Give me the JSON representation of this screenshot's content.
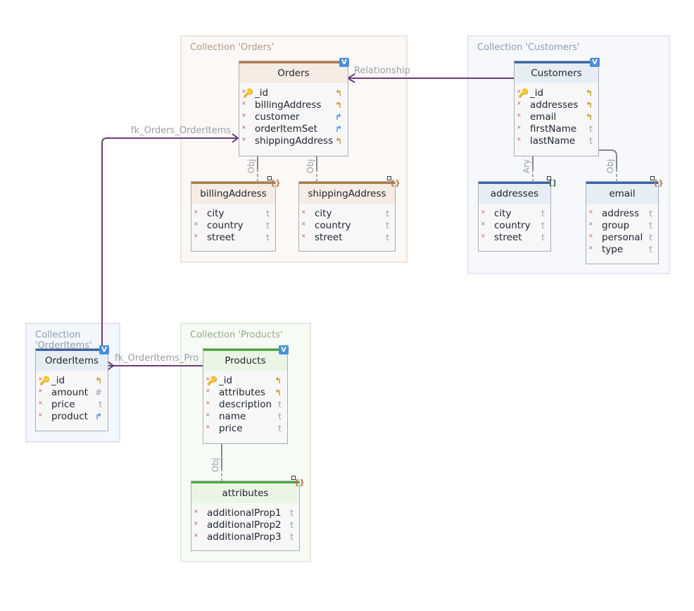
{
  "containers": {
    "orders": {
      "title": "Collection 'Orders'"
    },
    "customers": {
      "title": "Collection 'Customers'"
    },
    "orderitems": {
      "title": "Collection 'OrderItems'"
    },
    "products": {
      "title": "Collection 'Products'"
    }
  },
  "entities": {
    "orders": {
      "name": "Orders",
      "badge": "V",
      "fields": [
        {
          "name": "_id",
          "type": "↰",
          "key": true
        },
        {
          "name": "billingAddress",
          "type": "↰"
        },
        {
          "name": "customer",
          "type": "↱"
        },
        {
          "name": "orderItemSet",
          "type": "↱"
        },
        {
          "name": "shippingAddress",
          "type": "↰"
        }
      ]
    },
    "billingAddress": {
      "name": "billingAddress",
      "icon": "{}",
      "fields": [
        {
          "name": "city",
          "type": "t"
        },
        {
          "name": "country",
          "type": "t"
        },
        {
          "name": "street",
          "type": "t"
        }
      ]
    },
    "shippingAddress": {
      "name": "shippingAddress",
      "icon": "{}",
      "fields": [
        {
          "name": "city",
          "type": "t"
        },
        {
          "name": "country",
          "type": "t"
        },
        {
          "name": "street",
          "type": "t"
        }
      ]
    },
    "customers": {
      "name": "Customers",
      "badge": "V",
      "fields": [
        {
          "name": "_id",
          "type": "↰",
          "key": true
        },
        {
          "name": "addresses",
          "type": "↰"
        },
        {
          "name": "email",
          "type": "↰"
        },
        {
          "name": "firstName",
          "type": "t"
        },
        {
          "name": "lastName",
          "type": "t"
        }
      ]
    },
    "addresses": {
      "name": "addresses",
      "icon": "[]",
      "fields": [
        {
          "name": "city",
          "type": "t"
        },
        {
          "name": "country",
          "type": "t"
        },
        {
          "name": "street",
          "type": "t"
        }
      ]
    },
    "email": {
      "name": "email",
      "icon": "{}",
      "fields": [
        {
          "name": "address",
          "type": "t"
        },
        {
          "name": "group",
          "type": "t"
        },
        {
          "name": "personal",
          "type": "t"
        },
        {
          "name": "type",
          "type": "t"
        }
      ]
    },
    "orderitems": {
      "name": "OrderItems",
      "badge": "V",
      "fields": [
        {
          "name": "_id",
          "type": "↰",
          "key": true
        },
        {
          "name": "amount",
          "type": "#"
        },
        {
          "name": "price",
          "type": "t"
        },
        {
          "name": "product",
          "type": "↱"
        }
      ]
    },
    "products": {
      "name": "Products",
      "badge": "V",
      "fields": [
        {
          "name": "_id",
          "type": "↰",
          "key": true
        },
        {
          "name": "attributes",
          "type": "↰"
        },
        {
          "name": "description",
          "type": "t"
        },
        {
          "name": "name",
          "type": "t"
        },
        {
          "name": "price",
          "type": "t"
        }
      ]
    },
    "attributes": {
      "name": "attributes",
      "icon": "{}",
      "fields": [
        {
          "name": "additionalProp1",
          "type": "t"
        },
        {
          "name": "additionalProp2",
          "type": "t"
        },
        {
          "name": "additionalProp3",
          "type": "t"
        }
      ]
    }
  },
  "connectors": {
    "relationship": "Relationship",
    "fk_orders_orderitems": "fk_Orders_OrderItems",
    "fk_orderitems_products": "fk_OrderItems_Pro",
    "obj": "Obj",
    "ary": "Ary"
  },
  "colors": {
    "relation_line": "#6e3a78",
    "orders_accent": "#b07b47",
    "customers_accent": "#3b63a8",
    "products_accent": "#4caa3a"
  }
}
